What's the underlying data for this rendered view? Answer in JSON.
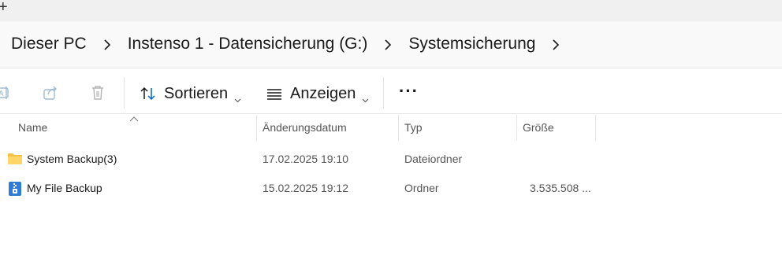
{
  "tabbar": {
    "new_tab_label": "+"
  },
  "breadcrumbs": [
    "Dieser PC",
    "Instenso 1 - Datensicherung (G:)",
    "Systemsicherung"
  ],
  "toolbar": {
    "sort_label": "Sortieren",
    "view_label": "Anzeigen",
    "more_label": "···"
  },
  "columns": {
    "name": "Name",
    "date": "Änderungsdatum",
    "type": "Typ",
    "size": "Größe"
  },
  "files": [
    {
      "name": "System Backup(3)",
      "date": "17.02.2025 19:10",
      "type": "Dateiordner",
      "size": "",
      "icon": "folder-icon"
    },
    {
      "name": "My File Backup",
      "date": "15.02.2025 19:12",
      "type": "Ordner",
      "size": "3.535.508 ...",
      "icon": "zip-archive-icon"
    }
  ],
  "colors": {
    "accent": "#0067c0",
    "folder": "#f5c046",
    "toolbar_bg": "#f9f9f9"
  }
}
